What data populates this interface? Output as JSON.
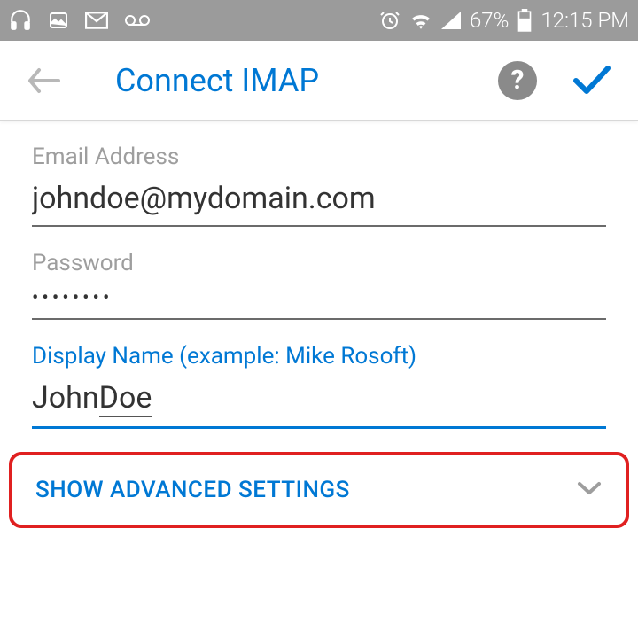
{
  "status": {
    "battery_percent": "67%",
    "time": "12:15 PM"
  },
  "header": {
    "title": "Connect IMAP"
  },
  "fields": {
    "email_label": "Email Address",
    "email_value": "johndoe@mydomain.com",
    "password_label": "Password",
    "password_value": "••••••••",
    "display_label": "Display Name (example: Mike Rosoft)",
    "display_first": "John ",
    "display_last": "Doe"
  },
  "advanced": {
    "label": "SHOW ADVANCED SETTINGS"
  }
}
